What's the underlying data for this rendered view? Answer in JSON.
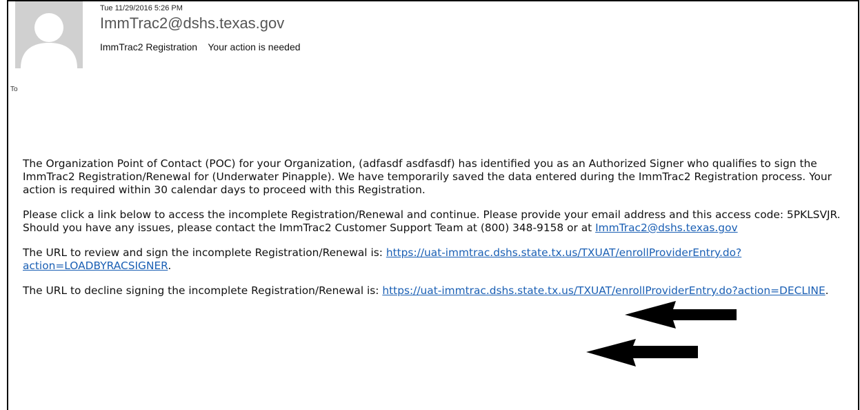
{
  "header": {
    "date": "Tue 11/29/2016 5:26 PM",
    "from": "ImmTrac2@dshs.texas.gov",
    "subject": "ImmTrac2 Registration    Your action is needed",
    "to_label": "To"
  },
  "body": {
    "p1": "The Organization Point of Contact (POC) for your Organization, (adfasdf asdfasdf) has identified you as an Authorized Signer who qualifies to sign the ImmTrac2 Registration/Renewal for (Underwater Pinapple).  We have temporarily saved the data entered during the ImmTrac2 Registration process.  Your action is required within 30 calendar days to proceed with this Registration.",
    "p2_text": "Please click a link below to access the incomplete Registration/Renewal and continue.  Please provide your email address and this access code: 5PKLSVJR.  Should you have any issues, please contact the ImmTrac2 Customer Support Team at (800) 348-9158 or at ",
    "p2_link": "ImmTrac2@dshs.texas.gov",
    "p3_text": "The URL to review and sign the incomplete Registration/Renewal is: ",
    "p3_link": "https://uat-immtrac.dshs.state.tx.us/TXUAT/enrollProviderEntry.do?action=LOADBYRACSIGNER",
    "p3_end": ".",
    "p4_text": "The URL to decline signing the incomplete Registration/Renewal is: ",
    "p4_link": "https://uat-immtrac.dshs.state.tx.us/TXUAT/enrollProviderEntry.do?action=DECLINE",
    "p4_end": "."
  },
  "icons": {
    "avatar": "person-placeholder-icon",
    "arrow": "left-arrow-icon"
  },
  "colors": {
    "link": "#1a5fb4",
    "avatar_bg": "#d0d0d0",
    "avatar_fg": "#ffffff"
  }
}
